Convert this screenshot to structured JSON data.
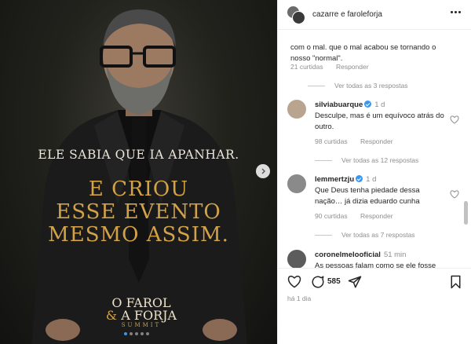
{
  "post": {
    "overlay_line_1": "ELE SABIA QUE IA APANHAR.",
    "overlay_line_2": "E CRIOU",
    "overlay_line_3": "ESSE EVENTO",
    "overlay_line_4": "MESMO ASSIM.",
    "logo_line_1": "O FAROL",
    "logo_amp": "&",
    "logo_line_2": "A FORJA",
    "logo_line_3": "SUMMIT",
    "carousel": {
      "slides": 5,
      "active_index": 0
    },
    "next_icon": "chevron-right-icon"
  },
  "header": {
    "title": "cazarre e faroleforja",
    "more_icon": "more-horizontal-icon"
  },
  "comments": {
    "fragment": {
      "text": "com o mal. que o mal acabou se tornando o nosso \"normal\".",
      "likes": "21 curtidas",
      "reply": "Responder",
      "view_replies": "Ver todas as 3 respostas"
    },
    "items": [
      {
        "user": "silviabuarque",
        "time": "1 d",
        "text": "Desculpe, mas é um equívoco atrás do outro.",
        "likes": "98 curtidas",
        "reply": "Responder",
        "view_replies": "Ver todas as 12 respostas"
      },
      {
        "user": "lemmertzju",
        "time": "1 d",
        "text": "Que Deus tenha piedade dessa nação… já dizia eduardo cunha",
        "likes": "90 curtidas",
        "reply": "Responder",
        "view_replies": "Ver todas as 7 respostas"
      },
      {
        "user": "coronelmelooficial",
        "time": "51 min",
        "text": "As pessoas falam como se ele fosse"
      }
    ]
  },
  "actions": {
    "like_icon": "heart-icon",
    "comment_icon": "comment-icon",
    "comment_count": "585",
    "share_icon": "send-icon",
    "save_icon": "bookmark-icon"
  },
  "posted_time": "há 1 dia",
  "colors": {
    "gold": "#d3a247",
    "verified": "#3897f0",
    "muted": "#8e8e8e"
  }
}
